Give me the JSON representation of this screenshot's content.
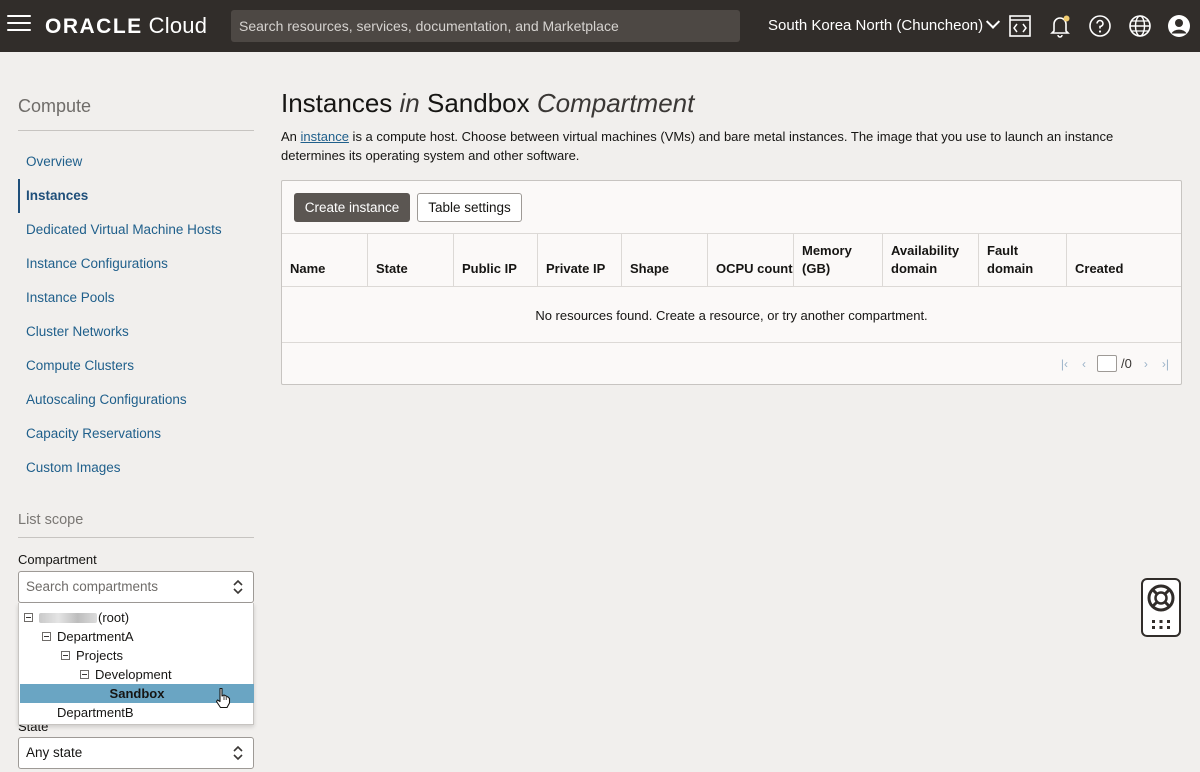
{
  "topbar": {
    "brand_bold": "ORACLE",
    "brand_light": "Cloud",
    "search_placeholder": "Search resources, services, documentation, and Marketplace",
    "region": "South Korea North (Chuncheon)"
  },
  "sidebar": {
    "title": "Compute",
    "items": [
      {
        "label": "Overview"
      },
      {
        "label": "Instances"
      },
      {
        "label": "Dedicated Virtual Machine Hosts"
      },
      {
        "label": "Instance Configurations"
      },
      {
        "label": "Instance Pools"
      },
      {
        "label": "Cluster Networks"
      },
      {
        "label": "Compute Clusters"
      },
      {
        "label": "Autoscaling Configurations"
      },
      {
        "label": "Capacity Reservations"
      },
      {
        "label": "Custom Images"
      }
    ],
    "scope_title": "List scope",
    "compartment_label": "Compartment",
    "compartment_placeholder": "Search compartments",
    "tree": {
      "root": "(root)",
      "dept_a": "DepartmentA",
      "projects": "Projects",
      "development": "Development",
      "sandbox": "Sandbox",
      "dept_b": "DepartmentB"
    },
    "state_label": "State",
    "state_value": "Any state"
  },
  "main": {
    "title_pre": "Instances ",
    "title_in": "in",
    "title_mid": " Sandbox ",
    "title_comp": "Compartment",
    "desc_pre": "An ",
    "desc_link": "instance",
    "desc_post": " is a compute host. Choose between virtual machines (VMs) and bare metal instances. The image that you use to launch an instance determines its operating system and other software.",
    "create_button": "Create instance",
    "settings_button": "Table settings",
    "columns": [
      "Name",
      "State",
      "Public IP",
      "Private IP",
      "Shape",
      "OCPU count",
      "Memory (GB)",
      "Availability domain",
      "Fault domain",
      "Created"
    ],
    "empty_message": "No resources found. Create a resource, or try another compartment.",
    "pager_total": "/0"
  },
  "colors": {
    "topbar": "#312d2a",
    "link": "#1f5f8b",
    "primary_button": "#5b5652",
    "selected_node": "#6aa5c3"
  }
}
